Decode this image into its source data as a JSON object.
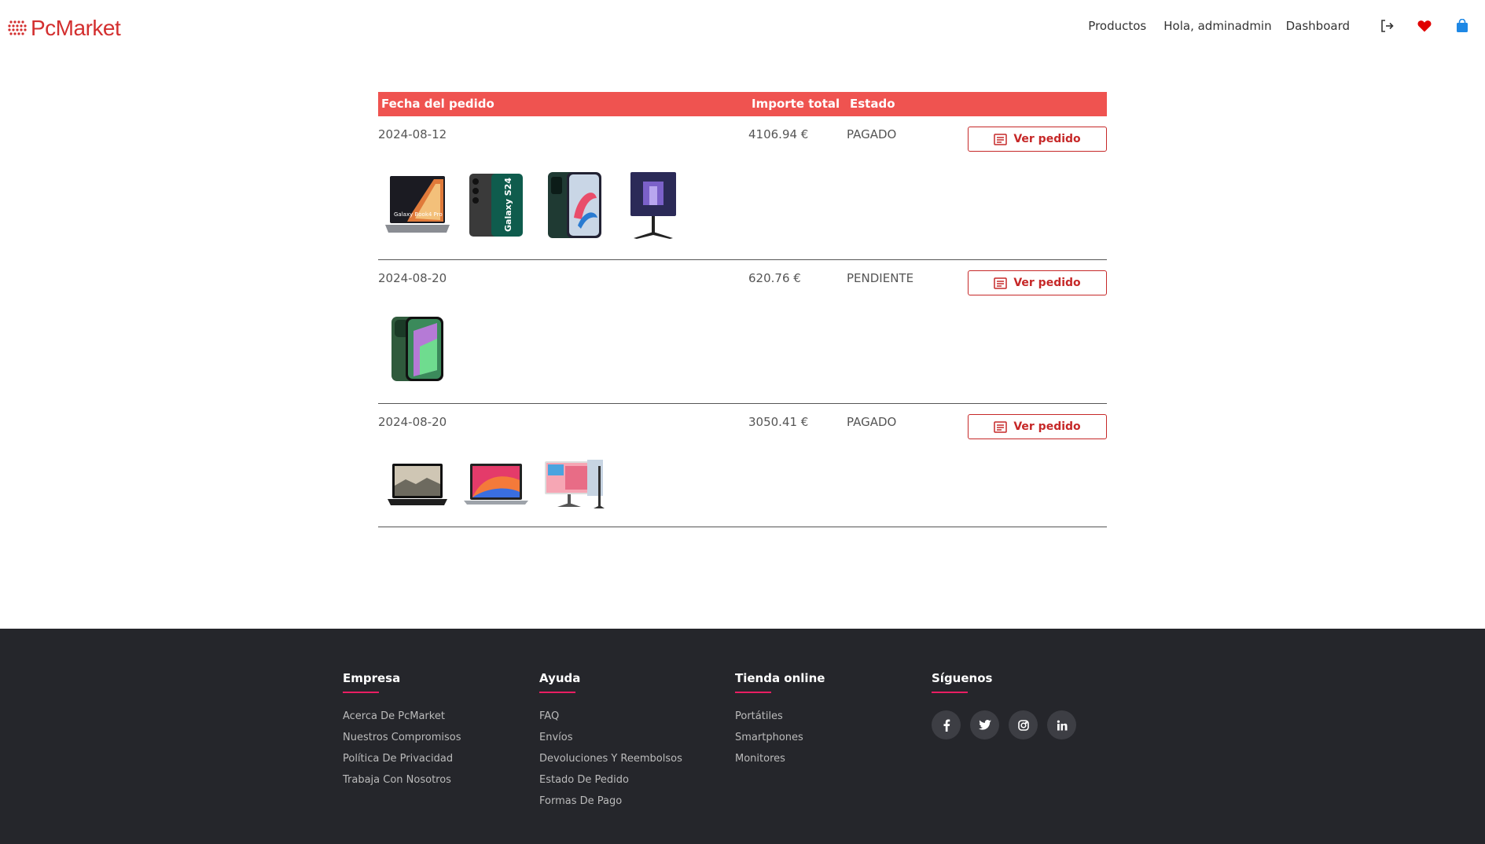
{
  "header": {
    "logo_text": "PcMarket",
    "nav": {
      "productos": "Productos",
      "greeting": "Hola, adminadmin",
      "dashboard": "Dashboard"
    },
    "icons": [
      "logout-icon",
      "heart-icon",
      "shopping-bag-icon"
    ],
    "colors": {
      "brand": "#d32f2f",
      "heart": "#e00000",
      "bag": "#1e88e5"
    }
  },
  "orders_table": {
    "headers": {
      "date": "Fecha del pedido",
      "total": "Importe total",
      "state": "Estado"
    },
    "header_color": "#ef5350",
    "view_label": "Ver pedido",
    "orders": [
      {
        "date": "2024-08-12",
        "total": "4106.94 €",
        "state": "PAGADO",
        "products": [
          "laptop-galaxy-book4-pro",
          "smartphone-galaxy-s24",
          "smartphone-oppo",
          "monitor-samsung-odyssey"
        ]
      },
      {
        "date": "2024-08-20",
        "total": "620.76 €",
        "state": "PENDIENTE",
        "products": [
          "smartphone-iphone-green"
        ]
      },
      {
        "date": "2024-08-20",
        "total": "3050.41 €",
        "state": "PAGADO",
        "products": [
          "laptop-surface",
          "laptop-macbook-air",
          "monitor-imac-style"
        ]
      }
    ]
  },
  "footer": {
    "columns": [
      {
        "title": "Empresa",
        "links": [
          "Acerca De PcMarket",
          "Nuestros Compromisos",
          "Política De Privacidad",
          "Trabaja Con Nosotros"
        ]
      },
      {
        "title": "Ayuda",
        "links": [
          "FAQ",
          "Envíos",
          "Devoluciones Y Reembolsos",
          "Estado De Pedido",
          "Formas De Pago"
        ]
      },
      {
        "title": "Tienda online",
        "links": [
          "Portátiles",
          "Smartphones",
          "Monitores"
        ]
      },
      {
        "title": "Síguenos",
        "social": [
          "facebook-icon",
          "twitter-icon",
          "instagram-icon",
          "linkedin-icon"
        ]
      }
    ],
    "accent": "#e91e63",
    "background": "#25262b"
  }
}
